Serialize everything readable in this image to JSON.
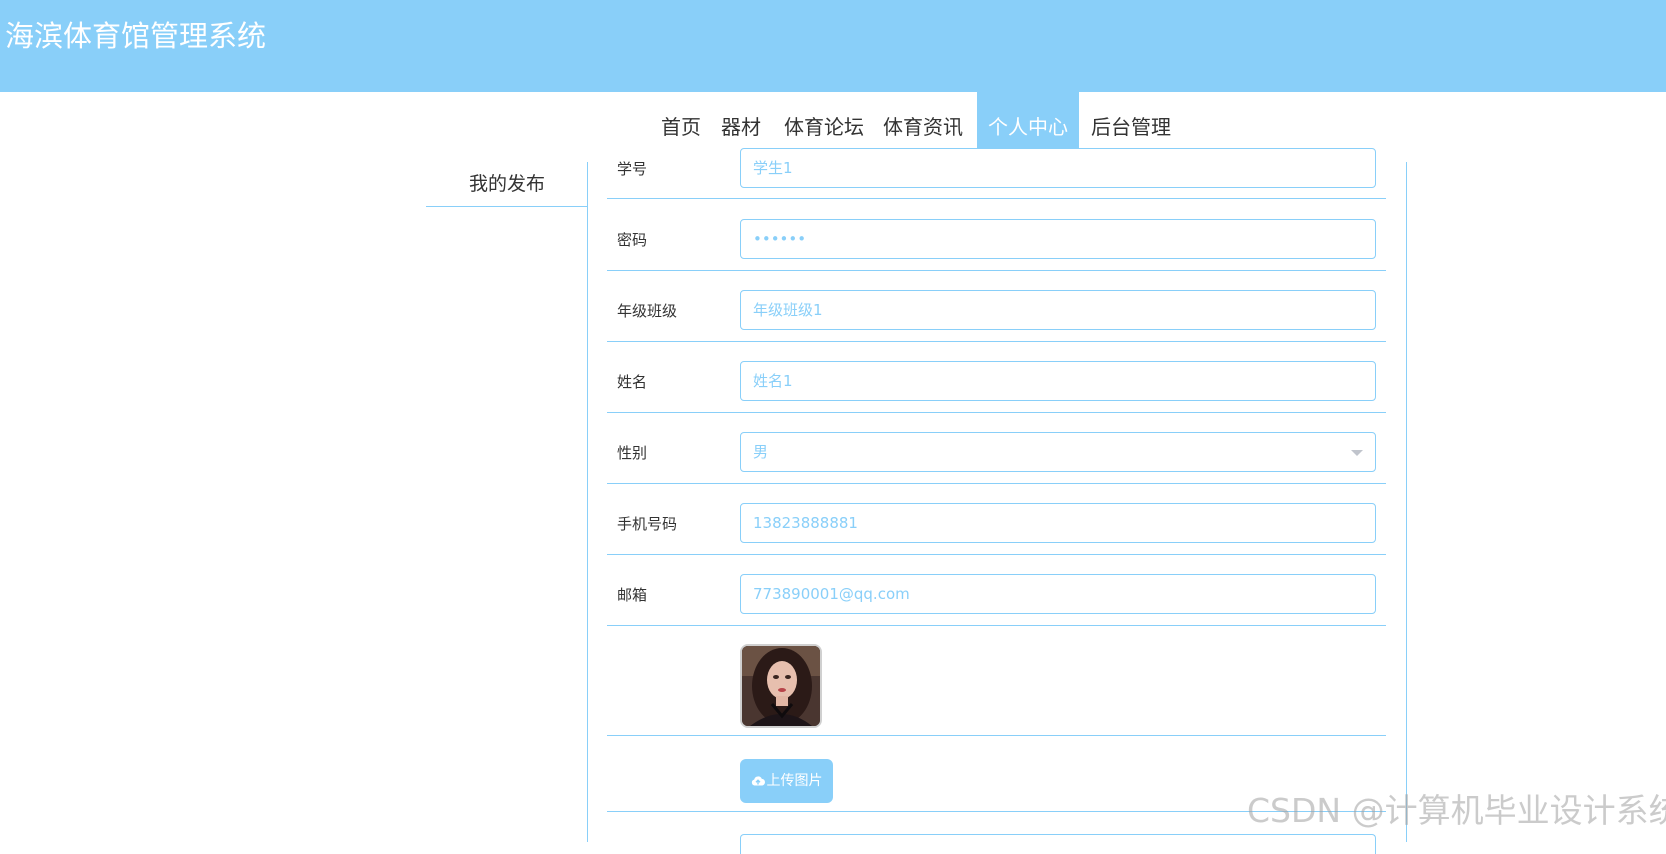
{
  "header": {
    "title": "海滨体育馆管理系统",
    "background": "#89cff9"
  },
  "nav": {
    "items": [
      {
        "label": "首页",
        "active": false
      },
      {
        "label": "器材",
        "active": false
      },
      {
        "label": "体育论坛",
        "active": false
      },
      {
        "label": "体育资讯",
        "active": false
      },
      {
        "label": "个人中心",
        "active": true
      },
      {
        "label": "后台管理",
        "active": false
      }
    ],
    "active_color": "#89cff9"
  },
  "sidebar": {
    "items": [
      {
        "label": "我的发布"
      }
    ]
  },
  "form": {
    "fields": [
      {
        "label": "学号",
        "value": "学生1"
      },
      {
        "label": "密码",
        "value": "••••••"
      },
      {
        "label": "年级班级",
        "value": "年级班级1"
      },
      {
        "label": "姓名",
        "value": "姓名1"
      },
      {
        "label": "性别",
        "value": "男"
      },
      {
        "label": "手机号码",
        "value": "13823888881"
      },
      {
        "label": "邮箱",
        "value": "773890001@qq.com"
      }
    ],
    "upload_label": "上传图片",
    "accent": "#89cff9"
  },
  "watermark": {
    "text": "CSDN @计算机毕业设计系统"
  }
}
